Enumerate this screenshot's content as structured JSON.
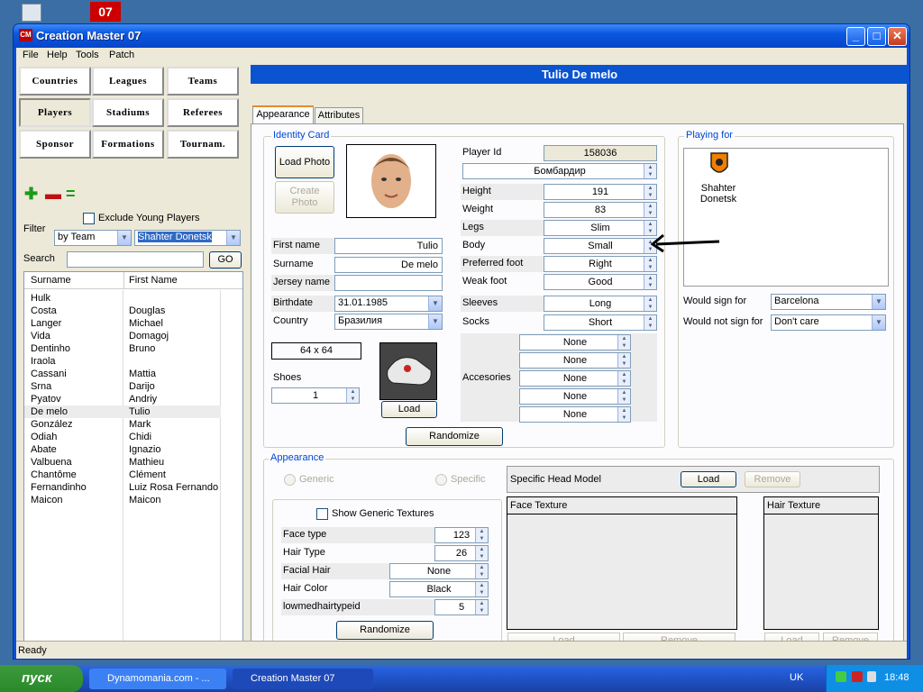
{
  "window": {
    "title": "Creation Master 07",
    "app_icon": "CM",
    "minimize": "_",
    "maximize": "□",
    "close": "✕"
  },
  "desktop": {
    "icon_b": "07"
  },
  "menu": [
    "File",
    "Help",
    "Tools",
    "Patch"
  ],
  "nav": [
    [
      "Countries",
      "Leagues",
      "Teams"
    ],
    [
      "Players",
      "Stadiums",
      "Referees"
    ],
    [
      "Sponsor",
      "Formations",
      "Tournam."
    ]
  ],
  "toolbar": {
    "add": "✚",
    "remove": "▬",
    "equals": "="
  },
  "filter": {
    "exclude_young": "Exclude Young Players",
    "filter_label": "Filter",
    "by": "by Team",
    "team": "Shahter Donetsk",
    "search_label": "Search",
    "go": "GO"
  },
  "list": {
    "col_surname": "Surname",
    "col_first": "First Name",
    "rows": [
      [
        "Hulk",
        ""
      ],
      [
        "Costa",
        "Douglas"
      ],
      [
        "Langer",
        "Michael"
      ],
      [
        "Vida",
        "Domagoj"
      ],
      [
        "Dentinho",
        "Bruno"
      ],
      [
        "Iraola",
        ""
      ],
      [
        "Cassani",
        "Mattia"
      ],
      [
        "Srna",
        "Darijo"
      ],
      [
        "Pyatov",
        "Andriy"
      ],
      [
        "De melo",
        "Tulio"
      ],
      [
        "González",
        "Mark"
      ],
      [
        "Odiah",
        "Chidi"
      ],
      [
        "Abate",
        "Ignazio"
      ],
      [
        "Valbuena",
        "Mathieu"
      ],
      [
        "Chantôme",
        "Clément"
      ],
      [
        "Fernandinho",
        "Luiz Rosa Fernando"
      ],
      [
        "Maicon",
        "Maicon"
      ]
    ]
  },
  "player": {
    "name": "Tulio De melo"
  },
  "tabs": [
    "Appearance",
    "Attributes"
  ],
  "identity": {
    "group": "Identity Card",
    "load_photo": "Load Photo",
    "create_photo": "Create Photo",
    "first_name_label": "First name",
    "first_name": "Tulio",
    "surname_label": "Surname",
    "surname": "De melo",
    "jersey_label": "Jersey name",
    "jersey": "",
    "birthdate_label": "Birthdate",
    "birthdate": "31.01.1985",
    "country_label": "Country",
    "country": "Бразилия",
    "size": "64 x 64",
    "shoes_label": "Shoes",
    "shoes": "1",
    "load": "Load"
  },
  "attrs": {
    "player_id_label": "Player Id",
    "player_id": "158036",
    "role": "Бомбардир",
    "rows": [
      [
        "Height",
        "191"
      ],
      [
        "Weight",
        "83"
      ],
      [
        "Legs",
        "Slim"
      ],
      [
        "Body",
        "Small"
      ],
      [
        "Preferred foot",
        "Right"
      ],
      [
        "Weak foot",
        "Good"
      ]
    ],
    "sleeves_label": "Sleeves",
    "sleeves": "Long",
    "socks_label": "Socks",
    "socks": "Short",
    "accessories_label": "Accesories",
    "accessories": [
      "None",
      "None",
      "None",
      "None",
      "None"
    ]
  },
  "randomize": "Randomize",
  "playing": {
    "group": "Playing for",
    "club": "Shahter Donetsk",
    "would_sign_label": "Would sign for",
    "would_sign": "Barcelona",
    "would_not_label": "Would not sign for",
    "would_not": "Don't care"
  },
  "appearance": {
    "group": "Appearance",
    "generic": "Generic",
    "specific": "Specific",
    "show_textures": "Show Generic Textures",
    "rows": [
      [
        "Face type",
        "123"
      ],
      [
        "Hair Type",
        "26"
      ],
      [
        "Facial Hair",
        "None"
      ],
      [
        "Hair Color",
        "Black"
      ],
      [
        "lowmedhairtypeid",
        "5"
      ]
    ],
    "randomize": "Randomize",
    "head_model": "Specific Head Model",
    "load": "Load",
    "remove": "Remove",
    "face_texture": "Face Texture",
    "hair_texture": "Hair Texture"
  },
  "status": "Ready",
  "taskbar": {
    "start": "пуск",
    "task1": "Dynamomania.com - ...",
    "task2": "Creation Master 07",
    "lang": "UK",
    "clock": "18:48"
  }
}
